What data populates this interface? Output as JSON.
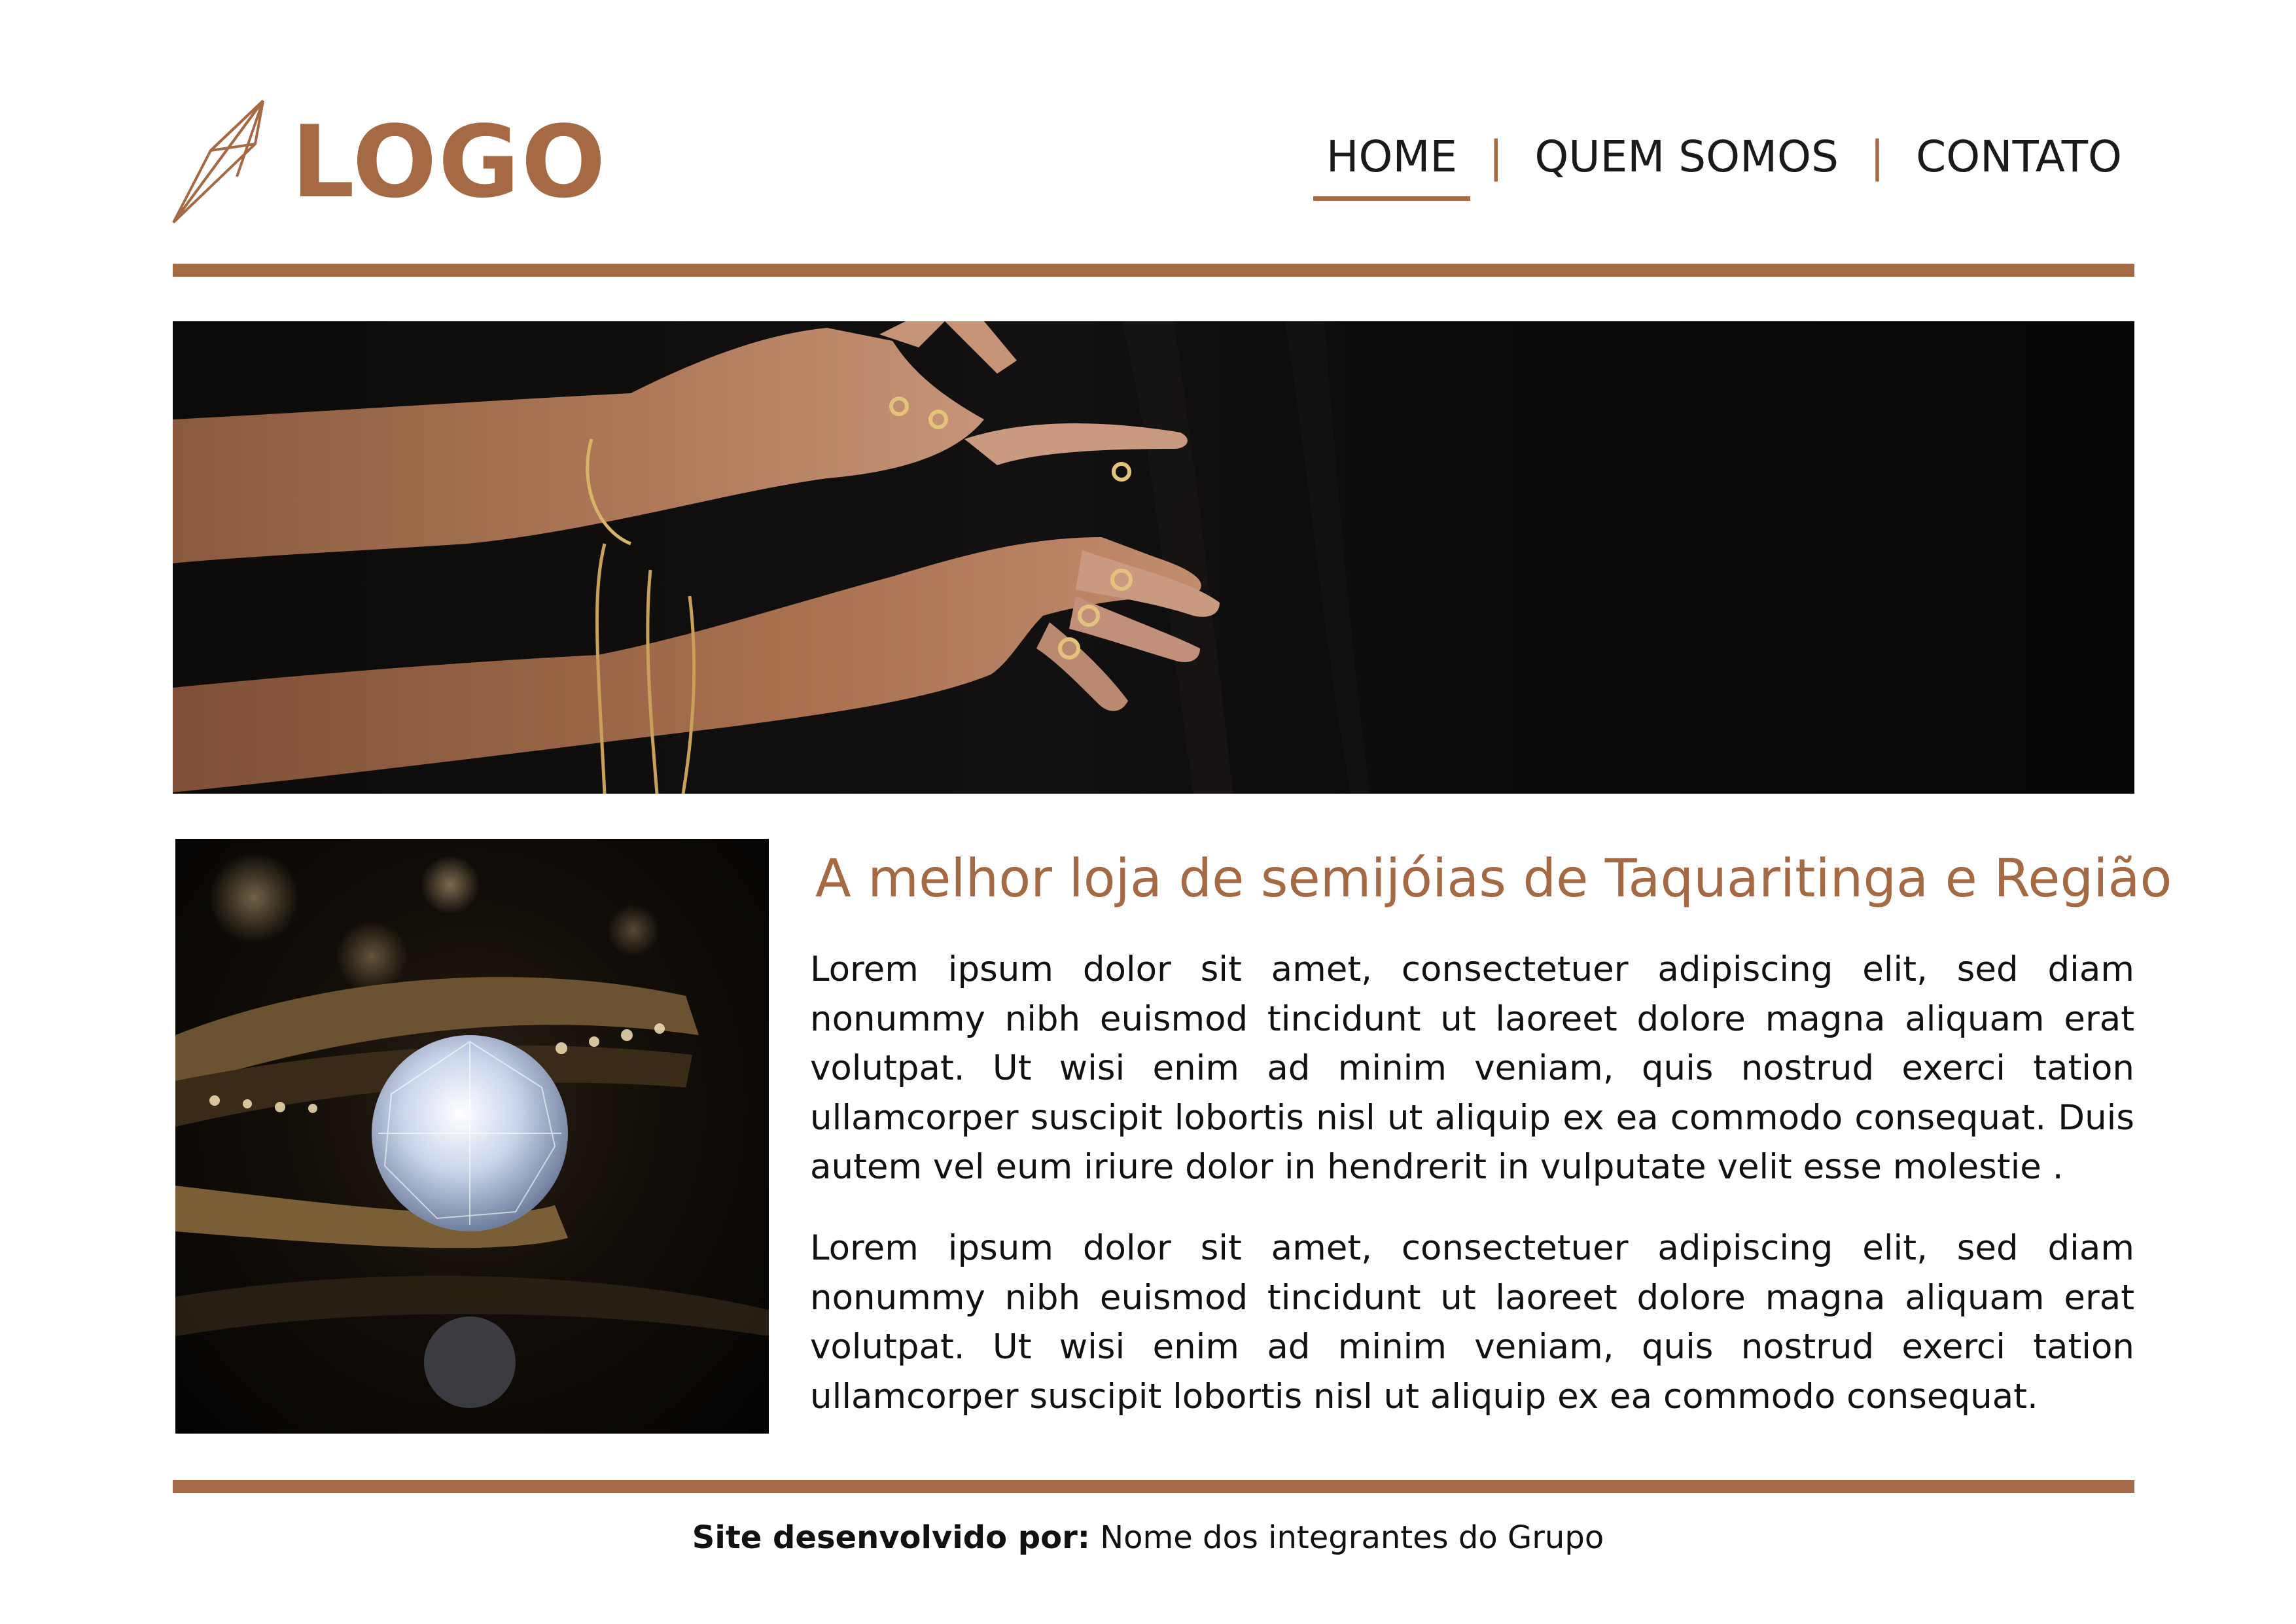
{
  "header": {
    "logo_text": "LOGO",
    "logo_icon": "diamond-outline-icon",
    "nav": [
      {
        "label": "HOME",
        "active": true
      },
      {
        "label": "QUEM SOMOS",
        "active": false
      },
      {
        "label": "CONTATO",
        "active": false
      }
    ],
    "nav_separator": "|"
  },
  "hero": {
    "image": "hands-with-gold-rings-and-bracelets-photo"
  },
  "content": {
    "image": "diamond-ring-photo",
    "headline": "A melhor loja de semijóias de Taquaritinga e Região",
    "paragraph_1": "Lorem ipsum dolor sit amet, consectetuer adipiscing elit, sed diam nonummy nibh euismod tincidunt ut laoreet dolore magna aliquam erat volutpat. Ut wisi enim ad minim veniam, quis nostrud exerci tation ullamcorper suscipit lobortis nisl ut aliquip ex ea commodo consequat. Duis autem vel eum iriure dolor in hendrerit in vulputate velit esse molestie .",
    "paragraph_2": "Lorem ipsum dolor sit amet, consectetuer adipiscing elit, sed diam nonummy nibh euismod tincidunt ut laoreet dolore magna aliquam erat volutpat. Ut wisi enim ad minim veniam, quis nostrud exerci tation ullamcorper suscipit lobortis nisl ut aliquip ex ea commodo consequat."
  },
  "footer": {
    "label": "Site desenvolvido por:",
    "value": "Nome dos integrantes do Grupo"
  },
  "colors": {
    "accent": "#a56a44",
    "text": "#111111",
    "background": "#ffffff"
  }
}
